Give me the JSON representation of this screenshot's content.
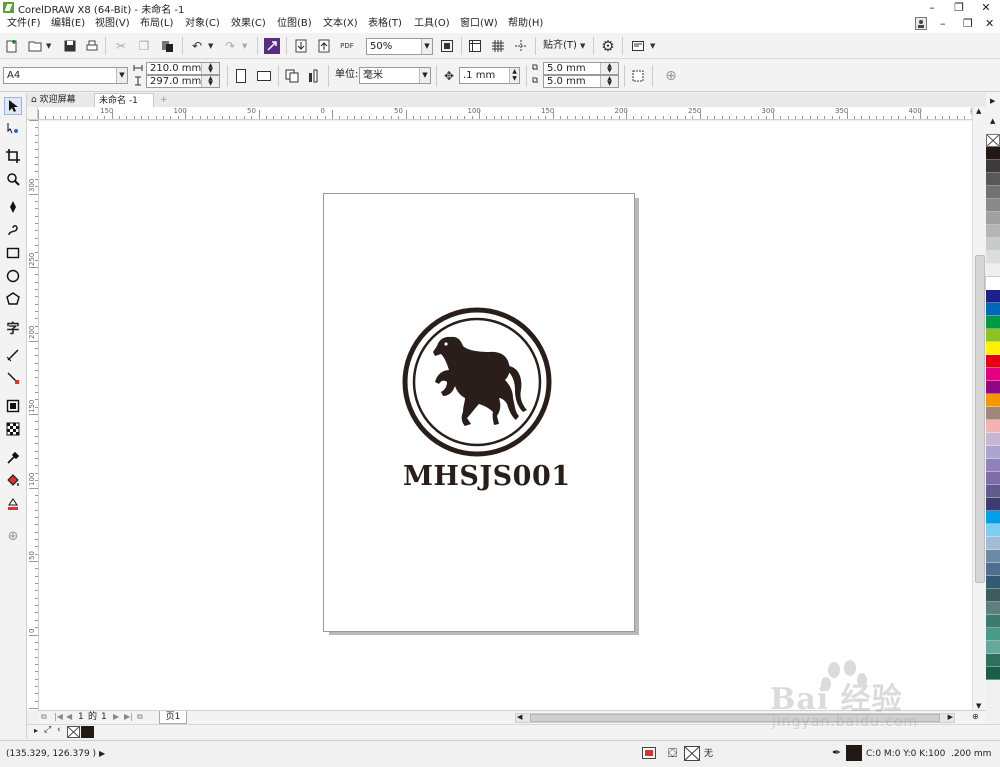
{
  "window": {
    "title": "CorelDRAW X8 (64-Bit) - 未命名 -1",
    "controls": [
      "–",
      "❐",
      "✕"
    ]
  },
  "menu": {
    "items": [
      "文件(F)",
      "编辑(E)",
      "视图(V)",
      "布局(L)",
      "对象(C)",
      "效果(C)",
      "位图(B)",
      "文本(X)",
      "表格(T)",
      "工具(O)",
      "窗口(W)",
      "帮助(H)"
    ],
    "window_controls": [
      "–",
      "❐",
      "✕"
    ]
  },
  "toolbar": {
    "zoom_value": "50%",
    "pdf_label": "PDF",
    "snap_label": "贴齐(T)"
  },
  "property_bar": {
    "page_size": "A4",
    "width": "210.0 mm",
    "height": "297.0 mm",
    "units_label": "单位:",
    "units_value": "毫米",
    "nudge": ".1 mm",
    "dup_x": "5.0 mm",
    "dup_y": "5.0 mm"
  },
  "tabs": {
    "welcome": "欢迎屏幕",
    "document": "未命名 -1",
    "add": "+"
  },
  "ruler": {
    "unit": "毫米",
    "h_labels": [
      "150",
      "100",
      "50",
      "0",
      "50",
      "100",
      "150",
      "200",
      "250",
      "300",
      "350",
      "400"
    ],
    "v_labels": [
      "300",
      "250",
      "200",
      "150",
      "100",
      "50",
      "0"
    ]
  },
  "artwork": {
    "logo_text": "MHSJS001",
    "ink_color": "#2a1e1a"
  },
  "page_nav": {
    "current": "1",
    "of_label": "的",
    "total": "1",
    "page_tab": "页1"
  },
  "status": {
    "coords": "(135.329, 126.379 )",
    "fill_none": "无",
    "color_info": "C:0 M:0 Y:0 K:100",
    "outline_width": ".200 mm"
  },
  "palette": [
    "#231815",
    "#3e3a39",
    "#595757",
    "#727171",
    "#898989",
    "#9fa0a0",
    "#b5b5b6",
    "#c9caca",
    "#dcdddd",
    "#efefef",
    "#ffffff",
    "#1d2088",
    "#0068b7",
    "#009944",
    "#8fc31f",
    "#fff100",
    "#e60012",
    "#e4007f",
    "#920783",
    "#f39800",
    "#a0877b",
    "#f5b2b2",
    "#c7b5d6",
    "#aba3d0",
    "#8f82bc",
    "#7e6ca8",
    "#5f5c8c",
    "#3c3c6e",
    "#00a0e9",
    "#7ecef4",
    "#a3bcd4",
    "#6b8aa6",
    "#4e6e8e",
    "#325b73",
    "#415a5c",
    "#5f7f7e",
    "#3b7b6e",
    "#4a9a88",
    "#66a899",
    "#2f6f5e",
    "#1a5e4a"
  ],
  "watermark": {
    "brand": "Bai  经验",
    "url": "jingyan.baidu.com"
  }
}
